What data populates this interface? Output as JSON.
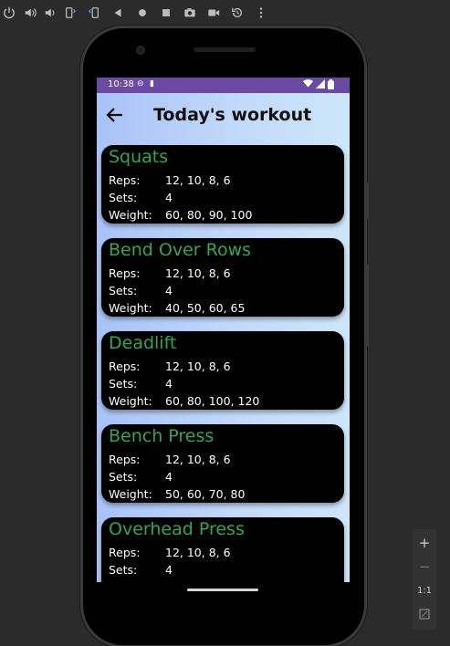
{
  "emulator_toolbar": {
    "icons": [
      "power-icon",
      "volume-up-icon",
      "volume-down-icon",
      "rotate-left-icon",
      "rotate-right-icon",
      "back-icon",
      "home-icon",
      "overview-icon",
      "screenshot-icon",
      "screen-record-icon",
      "snapshot-icon",
      "more-icon"
    ]
  },
  "status_bar": {
    "time": "10:38",
    "color": "#6a4aa3"
  },
  "app_bar": {
    "title": "Today's workout"
  },
  "labels": {
    "reps": "Reps:",
    "sets": "Sets:",
    "weight": "Weight:"
  },
  "exercises": [
    {
      "name": "Squats",
      "reps": "12, 10, 8, 6",
      "sets": "4",
      "weight": "60, 80, 90, 100"
    },
    {
      "name": "Bend Over Rows",
      "reps": "12, 10, 8, 6",
      "sets": "4",
      "weight": "40, 50, 60, 65"
    },
    {
      "name": "Deadlift",
      "reps": "12, 10, 8, 6",
      "sets": "4",
      "weight": "60, 80, 100, 120"
    },
    {
      "name": "Bench Press",
      "reps": "12, 10, 8, 6",
      "sets": "4",
      "weight": "50, 60, 70, 80"
    },
    {
      "name": "Overhead Press",
      "reps": "12, 10, 8, 6",
      "sets": "4",
      "weight": ""
    }
  ],
  "colors": {
    "exercise_title": "#2ea84f",
    "card_background": "#000000"
  },
  "zoom_controls": {
    "zoom_in": "+",
    "zoom_out": "−",
    "actual_size": "1:1"
  }
}
